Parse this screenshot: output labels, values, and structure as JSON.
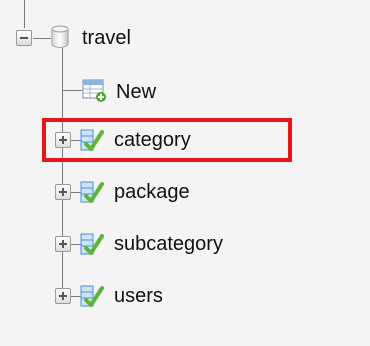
{
  "tree": {
    "database": {
      "label": "travel",
      "icon": "database-icon"
    },
    "items": [
      {
        "label": "New",
        "icon": "new-table-icon",
        "expandable": false
      },
      {
        "label": "category",
        "icon": "table-icon",
        "expandable": true,
        "highlighted": true
      },
      {
        "label": "package",
        "icon": "table-icon",
        "expandable": true
      },
      {
        "label": "subcategory",
        "icon": "table-icon",
        "expandable": true
      },
      {
        "label": "users",
        "icon": "table-icon",
        "expandable": true
      }
    ]
  },
  "colors": {
    "highlight": "#e8161c",
    "table_icon_green": "#5fb436",
    "table_icon_blue": "#4a90d9"
  }
}
